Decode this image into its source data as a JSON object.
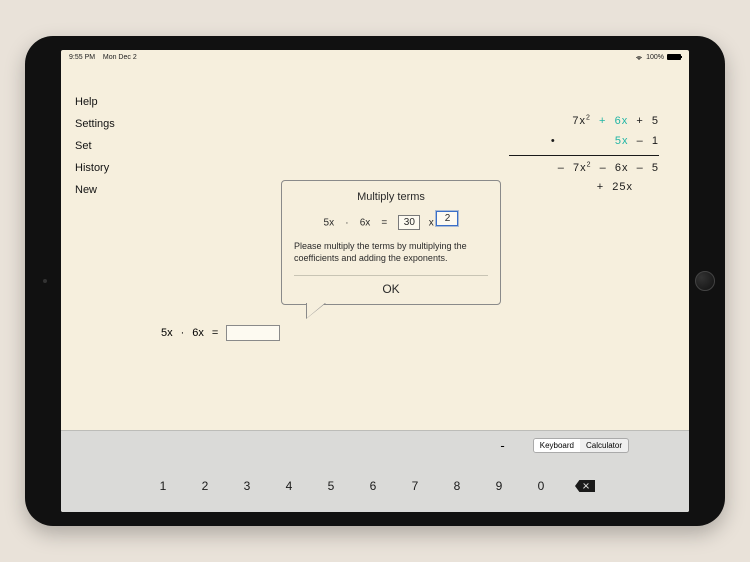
{
  "status": {
    "time": "9:55 PM",
    "date": "Mon Dec 2",
    "battery": "100%"
  },
  "menu": {
    "items": [
      {
        "label": "Help"
      },
      {
        "label": "Settings"
      },
      {
        "label": "Set"
      },
      {
        "label": "History"
      },
      {
        "label": "New"
      }
    ]
  },
  "work": {
    "r1_a": "7x",
    "r1_b": "6x",
    "r1_c": "5",
    "r2_dot": "•",
    "r2_a": "5x",
    "r2_b": "1",
    "r3_a": "7x",
    "r3_b": "6x",
    "r3_c": "5",
    "r4_a": "25x"
  },
  "popup": {
    "title": "Multiply terms",
    "lhs1": "5x",
    "dot": "·",
    "lhs2": "6x",
    "eq": "=",
    "coef": "30",
    "times": "x",
    "exp": "2",
    "hint": "Please multiply the terms by multiplying the coefficients and adding the exponents.",
    "ok": "OK"
  },
  "bottomeq": {
    "a": "5x",
    "dot": "·",
    "b": "6x",
    "eq": "="
  },
  "keypad": {
    "minus": "-",
    "seg_a": "Keyboard",
    "seg_b": "Calculator",
    "keys": [
      "1",
      "2",
      "3",
      "4",
      "5",
      "6",
      "7",
      "8",
      "9",
      "0"
    ]
  }
}
